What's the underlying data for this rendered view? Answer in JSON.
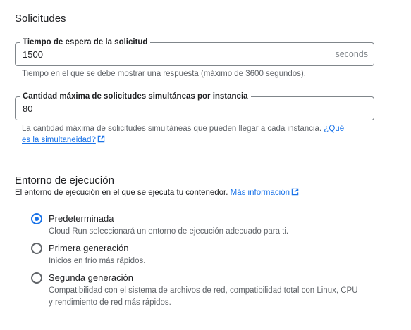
{
  "requests": {
    "title": "Solicitudes",
    "timeout": {
      "label": "Tiempo de espera de la solicitud",
      "value": "1500",
      "suffix": "seconds",
      "help": "Tiempo en el que se debe mostrar una respuesta (máximo de 3600 segundos)."
    },
    "concurrency": {
      "label": "Cantidad máxima de solicitudes simultáneas por instancia",
      "value": "80",
      "help": "La cantidad máxima de solicitudes simultáneas que pueden llegar a cada instancia.",
      "link_line1": "¿Qué",
      "link_line2": "es la simultaneidad?"
    }
  },
  "environment": {
    "title": "Entorno de ejecución",
    "description": "El entorno de ejecución en el que se ejecuta tu contenedor.",
    "link": "Más información",
    "options": [
      {
        "label": "Predeterminada",
        "description": "Cloud Run seleccionará un entorno de ejecución adecuado para ti.",
        "selected": true
      },
      {
        "label": "Primera generación",
        "description": "Inicios en frío más rápidos.",
        "selected": false
      },
      {
        "label": "Segunda generación",
        "description_line1": "Compatibilidad con el sistema de archivos de red, compatibilidad total con Linux, CPU",
        "description_line2": "y rendimiento de red más rápidos.",
        "selected": false
      }
    ]
  },
  "colors": {
    "accent": "#1a73e8",
    "border": "#80868b",
    "muted": "#5f6368"
  }
}
